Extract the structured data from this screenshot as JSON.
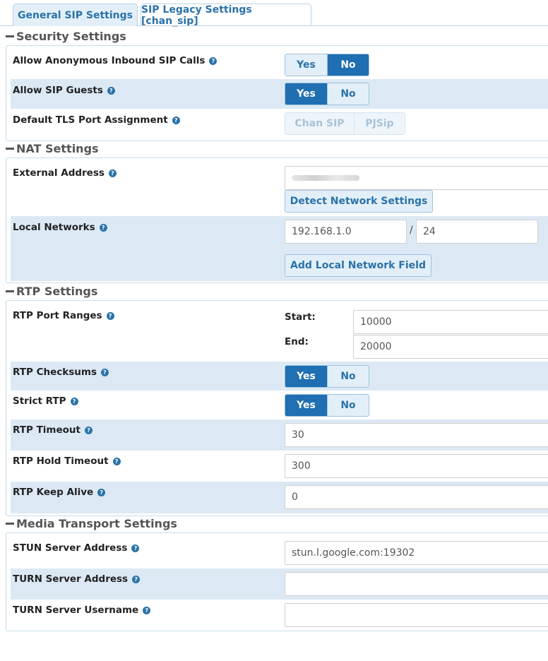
{
  "tabs": [
    {
      "label": "General SIP Settings",
      "active": true
    },
    {
      "label": "SIP Legacy Settings [chan_sip]",
      "active": false
    }
  ],
  "security": {
    "title": "Security Settings",
    "allow_anon": {
      "label": "Allow Anonymous Inbound SIP Calls",
      "yes": "Yes",
      "no": "No",
      "selected": "No"
    },
    "allow_guests": {
      "label": "Allow SIP Guests",
      "yes": "Yes",
      "no": "No",
      "selected": "Yes"
    },
    "tls_port": {
      "label": "Default TLS Port Assignment",
      "opt1": "Chan SIP",
      "opt2": "PJSip"
    }
  },
  "nat": {
    "title": "NAT Settings",
    "external_address": {
      "label": "External Address",
      "value": ""
    },
    "detect_button": "Detect Network Settings",
    "local_networks": {
      "label": "Local Networks",
      "ip": "192.168.1.0",
      "separator": "/",
      "mask": "24"
    },
    "add_button": "Add Local Network Field"
  },
  "rtp": {
    "title": "RTP Settings",
    "port_ranges": {
      "label": "RTP Port Ranges",
      "start_label": "Start:",
      "start": "10000",
      "end_label": "End:",
      "end": "20000"
    },
    "checksums": {
      "label": "RTP Checksums",
      "yes": "Yes",
      "no": "No",
      "selected": "Yes"
    },
    "strict": {
      "label": "Strict RTP",
      "yes": "Yes",
      "no": "No",
      "selected": "Yes"
    },
    "timeout": {
      "label": "RTP Timeout",
      "value": "30"
    },
    "hold_timeout": {
      "label": "RTP Hold Timeout",
      "value": "300"
    },
    "keep_alive": {
      "label": "RTP Keep Alive",
      "value": "0"
    }
  },
  "media": {
    "title": "Media Transport Settings",
    "stun": {
      "label": "STUN Server Address",
      "value": "stun.l.google.com:19302"
    },
    "turn": {
      "label": "TURN Server Address",
      "value": ""
    },
    "turn_user": {
      "label": "TURN Server Username",
      "value": ""
    }
  },
  "help_glyph": "?",
  "colors": {
    "accent": "#2a72a8",
    "active_toggle": "#1f6fb2",
    "row_shade": "#dce9f5"
  }
}
